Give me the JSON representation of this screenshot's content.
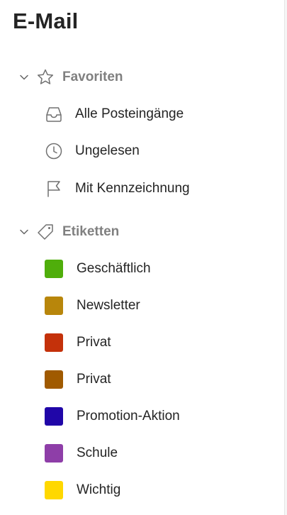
{
  "title": "E-Mail",
  "favorites": {
    "label": "Favoriten",
    "items": [
      {
        "label": "Alle Posteingänge",
        "icon": "inbox-icon"
      },
      {
        "label": "Ungelesen",
        "icon": "clock-icon"
      },
      {
        "label": "Mit Kennzeichnung",
        "icon": "flag-icon"
      }
    ]
  },
  "labels": {
    "label": "Etiketten",
    "items": [
      {
        "label": "Geschäftlich",
        "color": "#4fae0b"
      },
      {
        "label": "Newsletter",
        "color": "#b8860b"
      },
      {
        "label": "Privat",
        "color": "#c4310a"
      },
      {
        "label": "Privat",
        "color": "#a05a00"
      },
      {
        "label": "Promotion-Aktion",
        "color": "#2006a8"
      },
      {
        "label": "Schule",
        "color": "#8e3ea8"
      },
      {
        "label": "Wichtig",
        "color": "#ffd800"
      }
    ]
  }
}
